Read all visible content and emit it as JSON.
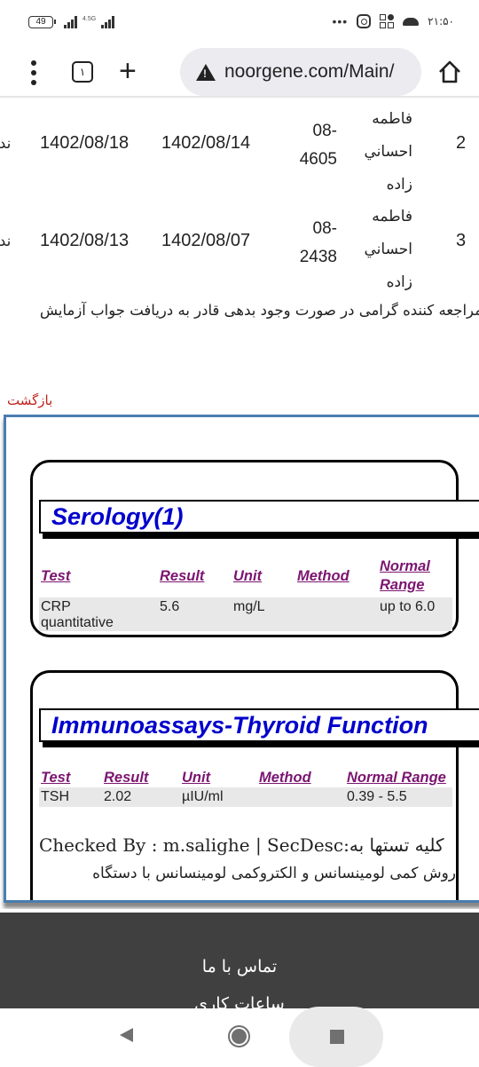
{
  "status_bar": {
    "battery": "49",
    "network_label": "4.5G",
    "time": "۲۱:۵۰",
    "icons": [
      "battery-icon",
      "signal-icon",
      "signal-4g-icon",
      "more-dots-icon",
      "instagram-icon",
      "apps-icon",
      "cloud-icon"
    ]
  },
  "browser": {
    "tab_count": "۱",
    "url": "noorgene.com/Main/",
    "icons": [
      "menu-icon",
      "tabs-icon",
      "new-tab-icon",
      "warning-icon",
      "home-icon"
    ]
  },
  "records": [
    {
      "index": "2",
      "name": "فاطمه احساني زاده",
      "code": "08-4605",
      "date_sample": "1402/08/14",
      "date_answer": "1402/08/18",
      "status_cut": "ندا"
    },
    {
      "index": "3",
      "name": "فاطمه احساني زاده",
      "code": "08-2438",
      "date_sample": "1402/08/07",
      "date_answer": "1402/08/13",
      "status_cut": "ندا"
    }
  ],
  "notice": "مراجعه کننده گرامی در صورت وجود بدهی قادر به دریافت جواب آزمایش",
  "back_link": "بازگشت",
  "sections": [
    {
      "title": "Serology(1)",
      "headers": [
        "Test",
        "Result",
        "Unit",
        "Method",
        "Normal Range"
      ],
      "rows": [
        {
          "test": "CRP quantitative",
          "result": "5.6",
          "unit": "mg/L",
          "method": "",
          "range": "up to 6.0"
        }
      ]
    },
    {
      "title": "Immunoassays-Thyroid Function",
      "headers": [
        "Test",
        "Result",
        "Unit",
        "Method",
        "Normal Range"
      ],
      "rows": [
        {
          "test": "TSH",
          "result": "2.02",
          "unit": "µIU/ml",
          "method": "",
          "range": "0.39 - 5.5"
        }
      ],
      "checked_by": "Checked By : m.salighe | SecDesc:کلیه تستها به",
      "checked_line2": "روش کمی لومینسانس و الکتروکمی لومینسانس با دستگاه"
    }
  ],
  "footer": {
    "contact": "تماس با ما",
    "hours": "ساعات کاری"
  },
  "colors": {
    "section_title": "#0000cc",
    "table_header": "#7b1570",
    "back_link": "#c0201a",
    "outer_border": "#4a7db0",
    "footer_bg": "#404040"
  }
}
